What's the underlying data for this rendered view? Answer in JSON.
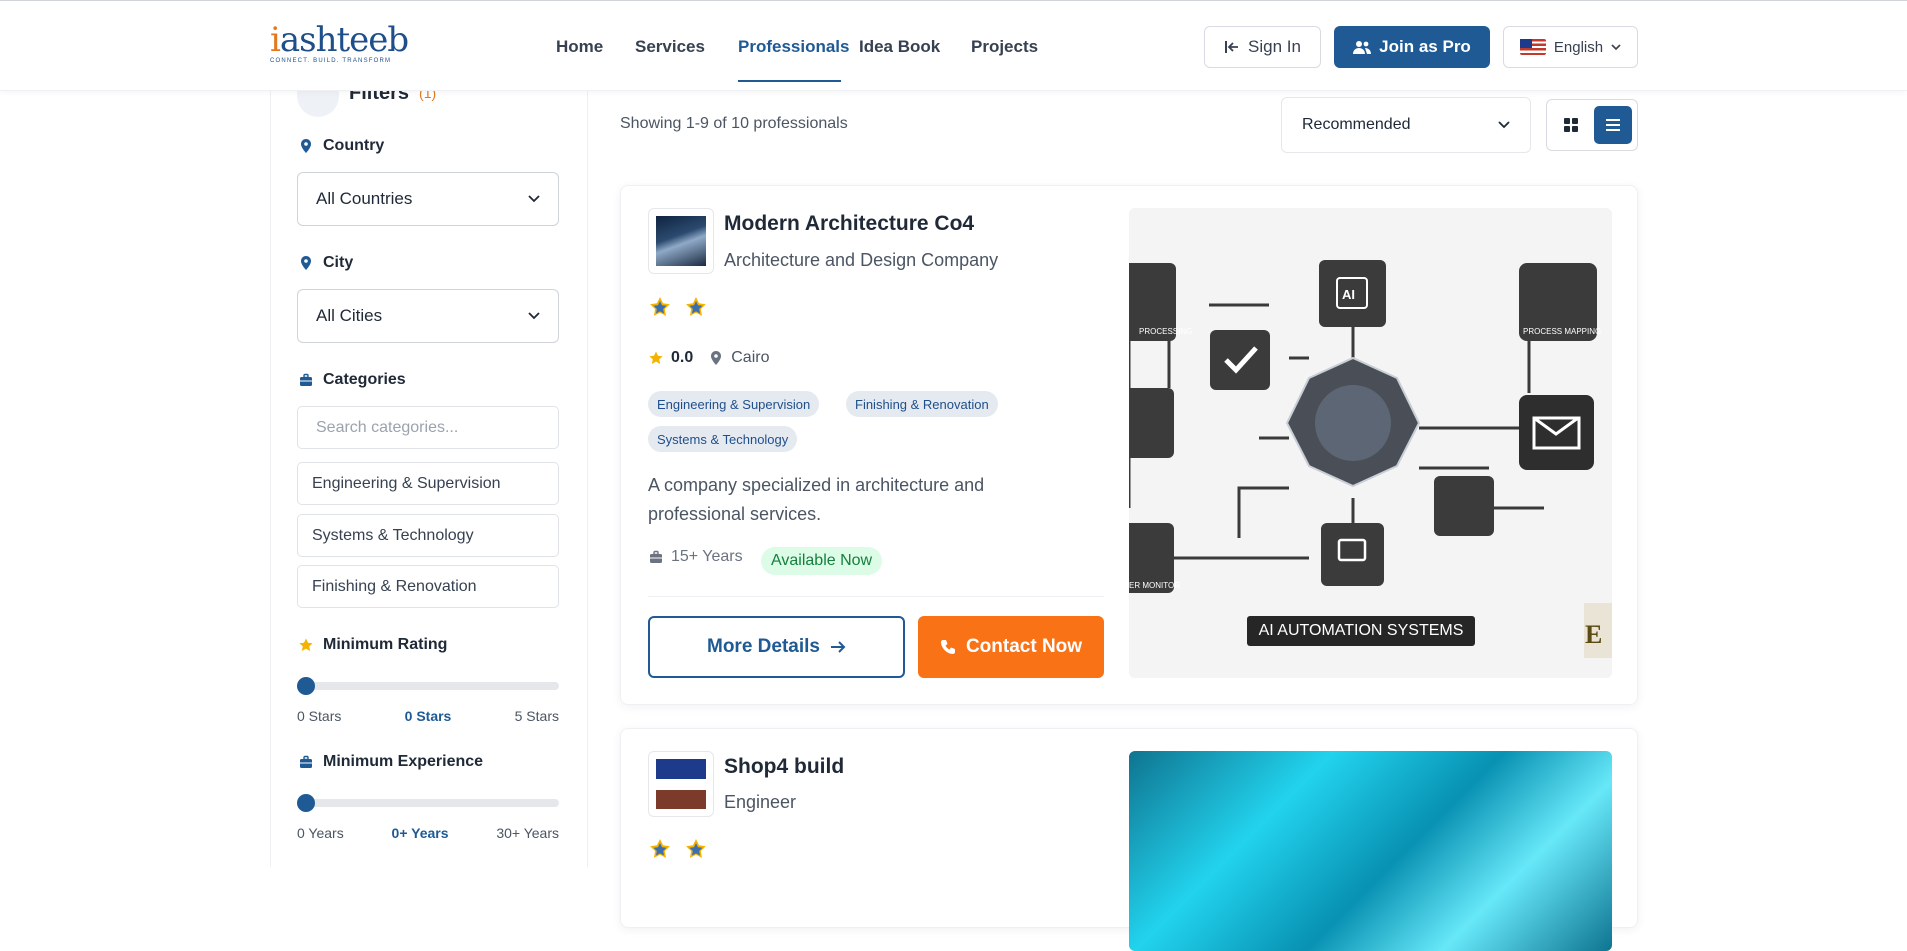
{
  "brand": {
    "logo_main": "iashteeb",
    "logo_tagline": "CONNECT. BUILD. TRANSFORM"
  },
  "nav": {
    "items": [
      {
        "label": "Home",
        "active": false
      },
      {
        "label": "Services",
        "active": false
      },
      {
        "label": "Professionals",
        "active": true
      },
      {
        "label": "Idea Book",
        "active": false
      },
      {
        "label": "Projects",
        "active": false
      }
    ],
    "sign_in": "Sign In",
    "join_pro": "Join as Pro",
    "language": "English"
  },
  "sidebar": {
    "filters_label": "Filters",
    "filters_count": "(1)",
    "country": {
      "label": "Country",
      "value": "All Countries"
    },
    "city": {
      "label": "City",
      "value": "All Cities"
    },
    "categories": {
      "label": "Categories",
      "search_placeholder": "Search categories...",
      "items": [
        "Engineering & Supervision",
        "Systems & Technology",
        "Finishing & Renovation"
      ]
    },
    "min_rating": {
      "label": "Minimum Rating",
      "min_label": "0 Stars",
      "current_label": "0 Stars",
      "max_label": "5 Stars",
      "value": 0
    },
    "min_experience": {
      "label": "Minimum Experience",
      "min_label": "0 Years",
      "current_label": "0+ Years",
      "max_label": "30+ Years",
      "value": 0
    }
  },
  "results": {
    "showing": "Showing 1-9 of 10 professionals",
    "sort_value": "Recommended",
    "view_mode": "list"
  },
  "cards": [
    {
      "name": "Modern Architecture Co4",
      "subtitle": "Architecture and Design Company",
      "rating": "0.0",
      "location": "Cairo",
      "tags": [
        "Engineering & Supervision",
        "Finishing & Renovation",
        "Systems & Technology"
      ],
      "description": "A company specialized in architecture and professional services.",
      "experience": "15+ Years",
      "availability": "Available Now",
      "more_label": "More Details",
      "contact_label": "Contact Now",
      "cover_caption": "AI AUTOMATION SYSTEMS",
      "cover_labels": {
        "top_icon": "AI",
        "process_mapping": "PROCESS MAPPING",
        "processing": "PROCESSING",
        "monitor": "ER MONITOR"
      }
    },
    {
      "name": "Shop4 build",
      "subtitle": "Engineer"
    }
  ],
  "colors": {
    "primary": "#1f5a95",
    "accent": "#f97316",
    "available_bg": "#dcfce7",
    "available_fg": "#15803d"
  }
}
